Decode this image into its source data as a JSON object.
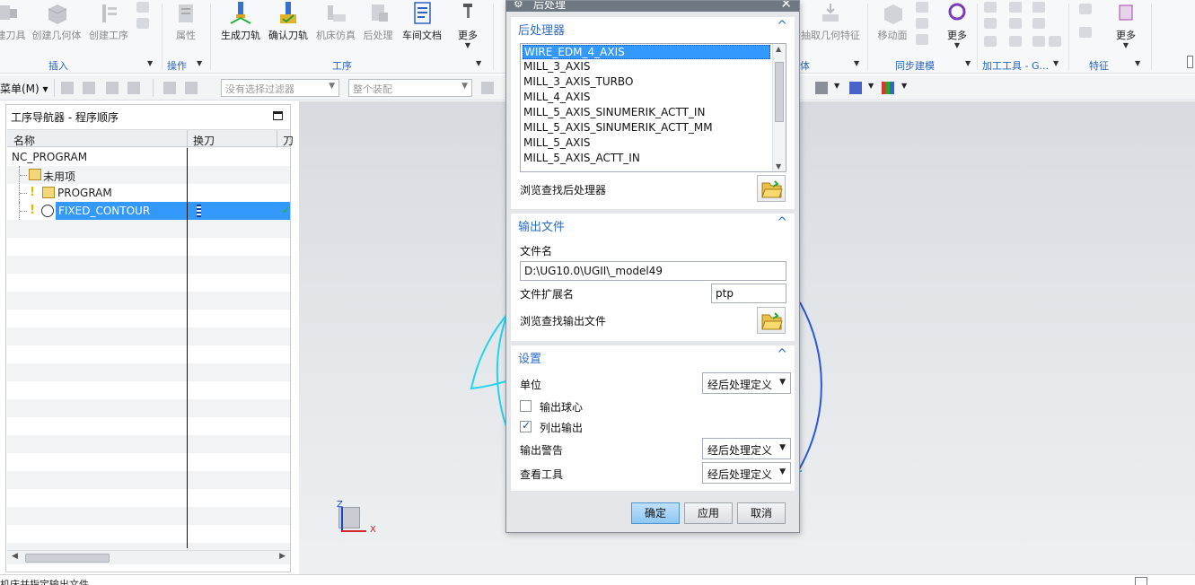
{
  "ribbon": {
    "buttons": [
      {
        "label": "建刀具",
        "dim": true
      },
      {
        "label": "创建几何体",
        "dim": true
      },
      {
        "label": "创建工序",
        "dim": true
      },
      {
        "label": "属性",
        "dim": true
      },
      {
        "label": "生成刀轨",
        "dim": false
      },
      {
        "label": "确认刀轨",
        "dim": false
      },
      {
        "label": "机床仿真",
        "dim": true
      },
      {
        "label": "后处理",
        "dim": true
      },
      {
        "label": "车间文档",
        "dim": false
      },
      {
        "label": "更多",
        "dim": false
      },
      {
        "label": "抽取几何特征",
        "dim": true
      },
      {
        "label": "移动面",
        "dim": true
      },
      {
        "label": "更多",
        "dim": false
      },
      {
        "label": "更多",
        "dim": false
      }
    ],
    "groups": [
      "插入",
      "操作",
      "工序",
      "体",
      "同步建模",
      "加工工具 - G...",
      "特征"
    ]
  },
  "toolbar": {
    "menu_label": "菜单(M)",
    "filter_placeholder": "没有选择过滤器",
    "assembly_placeholder": "整个装配"
  },
  "navigator": {
    "title": "工序导航器 - 程序顺序",
    "columns": [
      "名称",
      "换刀",
      "刀"
    ],
    "rows": [
      {
        "name": "NC_PROGRAM",
        "indent": 0,
        "icon": "none"
      },
      {
        "name": "未用项",
        "indent": 1,
        "icon": "folder-icon"
      },
      {
        "name": "PROGRAM",
        "indent": 1,
        "icon": "program-folder-icon"
      },
      {
        "name": "FIXED_CONTOUR",
        "indent": 2,
        "icon": "operation-icon",
        "selected": true
      }
    ]
  },
  "dialog": {
    "title": "后处理",
    "sections": {
      "postprocessor": {
        "title": "后处理器",
        "items": [
          "WIRE_EDM_4_AXIS",
          "MILL_3_AXIS",
          "MILL_3_AXIS_TURBO",
          "MILL_4_AXIS",
          "MILL_5_AXIS_SINUMERIK_ACTT_IN",
          "MILL_5_AXIS_SINUMERIK_ACTT_MM",
          "MILL_5_AXIS",
          "MILL_5_AXIS_ACTT_IN"
        ],
        "selected_index": 0,
        "browse_label": "浏览查找后处理器"
      },
      "output": {
        "title": "输出文件",
        "filename_label": "文件名",
        "filename_value": "D:\\UG10.0\\UGII\\_model49",
        "ext_label": "文件扩展名",
        "ext_value": "ptp",
        "browse_label": "浏览查找输出文件"
      },
      "settings": {
        "title": "设置",
        "unit_label": "单位",
        "unit_value": "经后处理定义",
        "ball_center_label": "输出球心",
        "ball_center_checked": false,
        "list_output_label": "列出输出",
        "list_output_checked": true,
        "warning_label": "输出警告",
        "warning_value": "经后处理定义",
        "review_label": "查看工具",
        "review_value": "经后处理定义"
      }
    },
    "buttons": {
      "ok": "确定",
      "apply": "应用",
      "cancel": "取消"
    }
  },
  "triad": {
    "z": "Z",
    "x": "X"
  },
  "status": {
    "text": "机床并指定输出文件"
  },
  "colors": {
    "accent": "#2d6cc8",
    "selection": "#3399ff",
    "arc_cyan": "#23d3ee",
    "arc_blue": "#2b56e0"
  }
}
